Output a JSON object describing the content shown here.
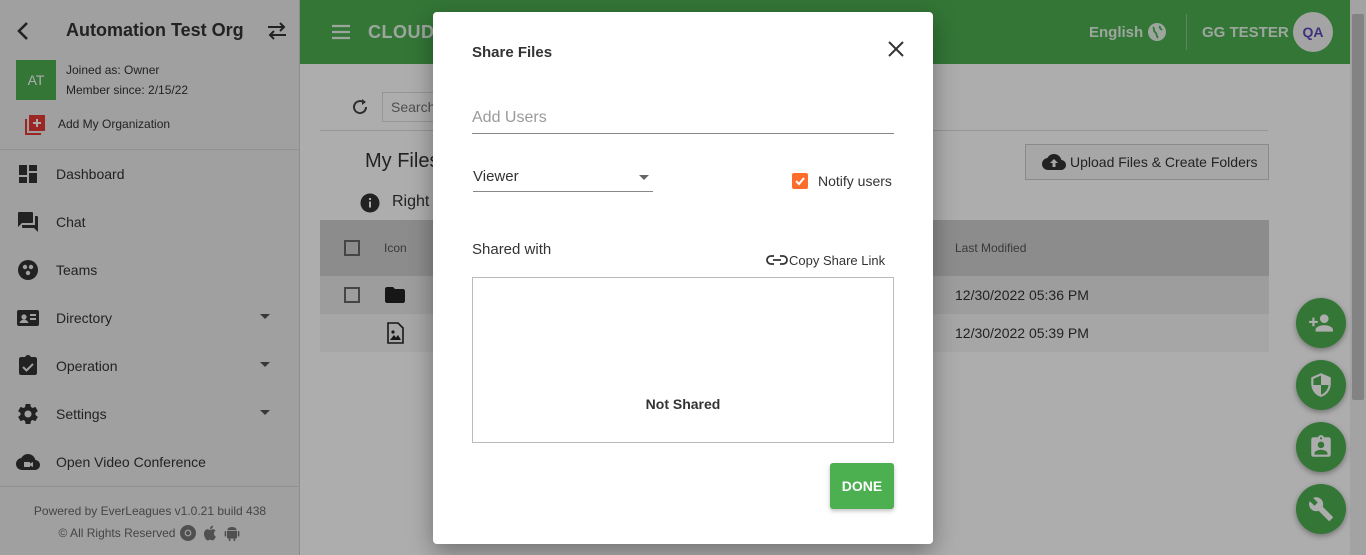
{
  "sidebar": {
    "org_name": "Automation Test Org",
    "avatar_initials": "AT",
    "joined_as": "Joined as: Owner",
    "member_since": "Member since: 2/15/22",
    "add_org": "Add My Organization",
    "nav": [
      {
        "label": "Dashboard",
        "icon": "dashboard-icon"
      },
      {
        "label": "Chat",
        "icon": "chat-icon"
      },
      {
        "label": "Teams",
        "icon": "teams-icon"
      },
      {
        "label": "Directory",
        "icon": "directory-icon"
      },
      {
        "label": "Operation",
        "icon": "clipboard-icon"
      },
      {
        "label": "Settings",
        "icon": "gear-icon"
      },
      {
        "label": "Open Video Conference",
        "icon": "video-cloud-icon"
      }
    ],
    "footer_powered": "Powered by EverLeagues v1.0.21 build 438",
    "footer_rights": "© All Rights Reserved"
  },
  "header": {
    "app_title": "CLOUD",
    "language": "English",
    "user_name": "GG TESTER",
    "user_avatar": "QA"
  },
  "main": {
    "search_placeholder": "Search",
    "title": "My Files",
    "upload_button": "Upload Files & Create Folders",
    "info_text": "Right",
    "columns": {
      "icon": "Icon",
      "last_modified": "Last Modified"
    },
    "rows": [
      {
        "type": "folder",
        "modified": "12/30/2022 05:36 PM"
      },
      {
        "type": "image",
        "modified": "12/30/2022 05:39 PM"
      }
    ]
  },
  "dialog": {
    "title": "Share Files",
    "add_users_placeholder": "Add Users",
    "role_value": "Viewer",
    "notify_label": "Notify users",
    "notify_checked": true,
    "shared_with_label": "Shared with",
    "copy_link_label": "Copy Share Link",
    "not_shared": "Not Shared",
    "done_label": "DONE"
  },
  "colors": {
    "primary_green": "#4caf50",
    "checkbox_orange": "#ff6d2d"
  }
}
